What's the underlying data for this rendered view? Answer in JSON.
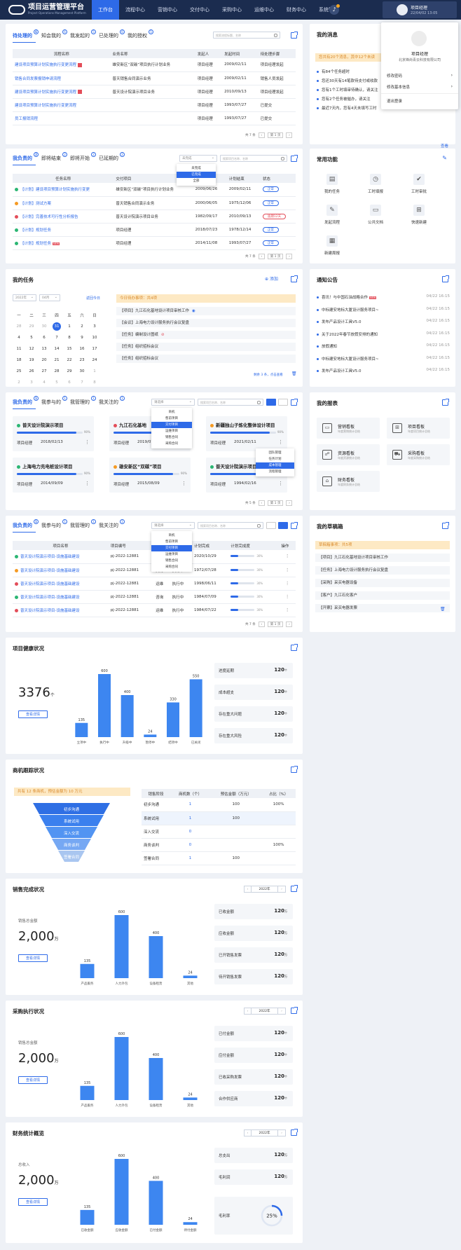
{
  "header": {
    "title": "项目运营管理平台",
    "subtitle": "Project Operations Management Platform",
    "nav": [
      "工作台",
      "流程中心",
      "营销中心",
      "交付中心",
      "采购中心",
      "运维中心",
      "财务中心",
      "系统管理"
    ],
    "user_name": "项目经理",
    "user_date": "22/04/02 13:05"
  },
  "profile": {
    "name": "项目经理",
    "company": "北京锋尚青云科技有限公司",
    "items": [
      "修改密码",
      "修改基本信息",
      "退出登录"
    ]
  },
  "todo": {
    "tabs": [
      "待处理的",
      "知会我的",
      "我发起的",
      "已处理的",
      "我的授权"
    ],
    "badges": [
      "6",
      "6",
      "5",
      "6",
      "5"
    ],
    "search": "搜索流程标题、名称",
    "headers": [
      "流程名称",
      "业务名称",
      "发起人",
      "发起时间",
      "待处理步骤"
    ],
    "rows": [
      [
        "建设项目预算计划实施执行变更流程",
        "雄安新区“双碳”项目执行计划业务",
        "项目经理",
        "2009/02/11",
        "项目经理发起"
      ],
      [
        "销售合同发票报销申请流程",
        "普天销售合同演示业务",
        "项目经理",
        "2009/02/11",
        "销售人员发起"
      ],
      [
        "建设项目预算计划实施执行变更流程",
        "普天设计院演示项目业务",
        "项目经理",
        "2010/09/13",
        "项目经理发起"
      ],
      [
        "建设项目预算计划实施执行变更流程",
        "",
        "项目经理",
        "1993/07/27",
        "已提交"
      ],
      [
        "员工报销流程",
        "",
        "项目经理",
        "1993/07/27",
        "已提交"
      ]
    ],
    "pager": {
      "total": "共 7 条",
      "page": "第 1 页"
    }
  },
  "messages": {
    "title": "我的消息",
    "notice": "您共有20个消息，其中12个未读",
    "rows": [
      "有84个任务超时",
      "您还30天有14笔款待支付或收款",
      "您有1个工时填审待确认，请关注",
      "您有2个任务被催办，请关注",
      "最近7天内，您有4天未填写工时"
    ],
    "view": "查看"
  },
  "resp": {
    "tabs": [
      "我负责的",
      "即将结束",
      "即将开始",
      "已延期的"
    ],
    "badges": [
      "2",
      "2",
      "2",
      "2"
    ],
    "filter": "未完成",
    "search": "搜索项目名称、名称",
    "dropdown": [
      "未完成",
      "已完成",
      "全部"
    ],
    "headers": [
      "任务名称",
      "交付项目",
      "计划开始",
      "计划结束",
      "状态"
    ],
    "rows": [
      [
        "【计划】建设项目预算计划实施执行变更",
        "雄安新区“双碳”项目执行计划业务",
        "2009/06/26",
        "2009/02/11",
        "正常"
      ],
      [
        "【计划】测试方案",
        "普天销售合同演示业务",
        "2000/06/05",
        "1975/12/06",
        "正常"
      ],
      [
        "【计划】完善技术可行性分析报告",
        "普天设计院演示项目业务",
        "1982/09/17",
        "2010/09/13",
        "逾期12天"
      ],
      [
        "【计划】规划任务",
        "项目经理",
        "2018/07/23",
        "1978/12/14",
        "正常"
      ],
      [
        "【计划】规划任务",
        "项目经理",
        "2014/11/08",
        "1993/07/27",
        "正常"
      ]
    ],
    "dotcolors": [
      "#2bb673",
      "#f59a23",
      "#e34d59",
      "#2bb673",
      "#2bb673"
    ],
    "pager": {
      "total": "共 7 条",
      "page": "第 1 页"
    }
  },
  "quick": {
    "title": "常用功能",
    "items": [
      "我的任务",
      "工时填报",
      "工时审批",
      "发起流程",
      "公共文档",
      "快速新建",
      "新建周报"
    ]
  },
  "mytask": {
    "title": "我的任务",
    "add": "添加",
    "year": "2022年",
    "month": "04月",
    "back": "返回今日",
    "weekdays": [
      "一",
      "二",
      "三",
      "四",
      "五",
      "六",
      "日"
    ],
    "weeks": [
      [
        "28",
        "29",
        "30",
        "31",
        "1",
        "2",
        "3"
      ],
      [
        "4",
        "5",
        "6",
        "7",
        "8",
        "9",
        "10"
      ],
      [
        "11",
        "12",
        "13",
        "14",
        "15",
        "16",
        "17"
      ],
      [
        "18",
        "19",
        "20",
        "21",
        "22",
        "23",
        "24"
      ],
      [
        "25",
        "26",
        "27",
        "28",
        "29",
        "30",
        "1"
      ],
      [
        "2",
        "3",
        "4",
        "5",
        "6",
        "7",
        "8"
      ]
    ],
    "notice": "今日待办事项：共4项",
    "items": [
      "【项目】九江石化基地设计项目审核工作",
      "【会议】上海电力设计服务执行会议复盘",
      "【任务】编制设计图纸",
      "【任务】组织招标会议",
      "【任务】组织招标会议"
    ],
    "more": "剩余 3 条，点击查看"
  },
  "notices": {
    "title": "通知公告",
    "new": "NEW",
    "rows": [
      [
        "喜讯！与中国石油战略合作",
        "04/22 16:15"
      ],
      [
        "中标建安地标大厦设计服务项目~",
        "04/22 16:15"
      ],
      [
        "发布产品设计工具V5.0",
        "04/22 16:15"
      ],
      [
        "关于2022年春节放假安排的通知",
        "04/22 16:15"
      ],
      [
        "放假通知",
        "04/22 16:15"
      ],
      [
        "中标建安地标大厦设计服务项目~",
        "04/22 16:15"
      ],
      [
        "发布产品设计工具V5.0",
        "04/22 16:15"
      ]
    ]
  },
  "projects": {
    "tabs": [
      "我负责的",
      "我参与的",
      "我管理的",
      "我关注的"
    ],
    "badges": [
      "1",
      "1",
      "1",
      "1"
    ],
    "filter": "请选择",
    "search": "搜索项目名称、名称",
    "dropdown": [
      "商机",
      "售前项目",
      "交付项目",
      "运维项目",
      "销售合同",
      "采购合同"
    ],
    "cards": [
      {
        "name": "普天设计院演示项目",
        "role": "项目经理",
        "date": "2018/02/13",
        "pct": "90%",
        "progress": 0.9,
        "color": "#2bb673"
      },
      {
        "name": "九江石化基地",
        "role": "项目经理",
        "date": "2019/07/23",
        "pct": "90%",
        "progress": 0.9,
        "color": "#e34d59"
      },
      {
        "name": "新疆独山子炼化整体设计项目",
        "role": "项目经理",
        "date": "2021/02/11",
        "pct": "90%",
        "progress": 0.9,
        "color": "#f59a23"
      },
      {
        "name": "上海电力充电桩设计项目",
        "role": "项目经理",
        "date": "2014/09/09",
        "pct": "90%",
        "progress": 0.9,
        "color": "#2bb673"
      },
      {
        "name": "雄安新区“双碳”项目",
        "role": "项目经理",
        "date": "2015/08/09",
        "pct": "90%",
        "progress": 0.9,
        "color": "#f59a23"
      },
      {
        "name": "普天设计院演示项目",
        "role": "项目经理",
        "date": "1994/02/16",
        "pct": "90%",
        "progress": 0.9,
        "color": "#2bb673"
      }
    ],
    "menu": [
      "团队管理",
      "任务计划",
      "成本管理",
      "流程管理"
    ],
    "pager": {
      "total": "共 5 条",
      "page": "第 1 页"
    }
  },
  "reports": {
    "title": "我的报表",
    "tiles": [
      {
        "t": "营销看板",
        "s": "年度营销统计总结"
      },
      {
        "t": "项目看板",
        "s": "年度项目统计总结"
      },
      {
        "t": "资源看板",
        "s": "年度资源统计总结"
      },
      {
        "t": "采购看板",
        "s": "年度采购统计总结"
      },
      {
        "t": "财务看板",
        "s": "年度财务统计总结"
      }
    ]
  },
  "ptable": {
    "tabs": [
      "我负责的",
      "我参与的",
      "我管理的",
      "我关注的"
    ],
    "badges": [
      "1",
      "1",
      "1",
      "1"
    ],
    "filter": "请选择",
    "search": "搜索项目名称、名称",
    "dropdown": [
      "商机",
      "售前项目",
      "交付项目",
      "运维项目",
      "销售合同",
      "采购合同"
    ],
    "headers": [
      "项目名称",
      "项目编号",
      "类型",
      "状态",
      "计划完成",
      "计划完成度",
      "操作"
    ],
    "rows": [
      [
        "普天设计院演示项目-设施基础建设",
        "pj-2022-12881",
        "交付",
        "执行中",
        "2020/10/29",
        "30%"
      ],
      [
        "普天设计院演示项目-设施基础建设",
        "pj-2022-12881",
        "交付",
        "执行中",
        "1972/07/28",
        "30%"
      ],
      [
        "普天设计院演示项目-设施基础建设",
        "pj-2022-12881",
        "运维",
        "执行中",
        "1998/06/11",
        "30%"
      ],
      [
        "普天设计院演示项目-设施基础建设",
        "pj-2022-12881",
        "咨询",
        "执行中",
        "1984/07/09",
        "30%"
      ],
      [
        "普天设计院演示项目-设施基础建设",
        "pj-2022-12881",
        "运维",
        "执行中",
        "1984/07/22",
        "30%"
      ]
    ],
    "progress": [
      0.3,
      0.3,
      0.3,
      0.3,
      0.3
    ],
    "dotcolors": [
      "#2bb673",
      "#f59a23",
      "#e34d59",
      "#2bb673",
      "#e34d59"
    ],
    "pager": {
      "total": "共 7 条",
      "page": "第 1 页"
    }
  },
  "drafts": {
    "title": "我的草稿箱",
    "notice": "草稿箱事项：共5项",
    "items": [
      "【项目】九江石化基地设计项目审核工作",
      "【任务】上海电力设计服务执行会议复盘",
      "【采购】采买电器设备",
      "【客户】九江石化客户",
      "【开票】采买电器发票"
    ]
  },
  "health": {
    "title": "项目健康状况",
    "total": "3376",
    "unit": "个",
    "btn": "查看详情",
    "stats": [
      [
        "进度延期",
        "120"
      ],
      [
        "成本超支",
        "120"
      ],
      [
        "存在重大问题",
        "120"
      ],
      [
        "存在重大风险",
        "120"
      ]
    ],
    "statunit": "个"
  },
  "funnel": {
    "title": "商机跟踪状况",
    "notice": "共有 12 条商机，预估金额为 10 万元",
    "stages": [
      "初步沟通",
      "系统试用",
      "深入交流",
      "商务谈判",
      "签署合同"
    ],
    "headers": [
      "销售阶段",
      "商机数（个）",
      "预估金额（万元）",
      "占比（%）"
    ],
    "rows": [
      [
        "初步沟通",
        "1",
        "100",
        "100%"
      ],
      [
        "系统试用",
        "1",
        "100",
        ""
      ],
      [
        "深入交流",
        "0",
        "",
        ""
      ],
      [
        "商务谈判",
        "0",
        "",
        "100%"
      ],
      [
        "签署合同",
        "1",
        "100",
        ""
      ]
    ]
  },
  "sales": {
    "title": "销售完成状况",
    "year": "2022年",
    "label": "销售总金额",
    "total": "2,000",
    "unit": "万",
    "btn": "查看详情",
    "stats": [
      [
        "已收金额",
        "120"
      ],
      [
        "应收金额",
        "120"
      ],
      [
        "已开销售发票",
        "120"
      ],
      [
        "待开销售发票",
        "120"
      ]
    ],
    "statunit": "万"
  },
  "purchase": {
    "title": "采购执行状况",
    "year": "2022年",
    "label": "销售总金额",
    "total": "2,000",
    "unit": "万",
    "btn": "查看详情",
    "stats": [
      [
        "已付金额",
        "120"
      ],
      [
        "应付金额",
        "120"
      ],
      [
        "已收采购发票",
        "120"
      ],
      [
        "合作供应商",
        "120"
      ]
    ],
    "statunit": "个"
  },
  "finance": {
    "title": "财务统计概览",
    "year": "2022年",
    "label": "总收入",
    "total": "2,000",
    "unit": "万",
    "btn": "查看详情",
    "stats": [
      [
        "总支出",
        "120"
      ],
      [
        "毛利润",
        "120"
      ]
    ],
    "statunit": "万",
    "rate_label": "毛利率",
    "rate": "25%",
    "rate_value": 0.25
  },
  "chart_data": [
    {
      "type": "bar",
      "categories": [
        "立项中",
        "执行中",
        "升级中",
        "暂停中",
        "结项中",
        "已关闭"
      ],
      "values": [
        135,
        600,
        400,
        24,
        330,
        550
      ],
      "ylim": [
        0,
        600
      ]
    },
    {
      "type": "bar",
      "categories": [
        "产品服务",
        "人力外包",
        "设备租赁",
        "其他"
      ],
      "values": [
        135,
        600,
        400,
        24
      ],
      "ylim": [
        0,
        600
      ]
    },
    {
      "type": "bar",
      "categories": [
        "产品服务",
        "人力外包",
        "设备租赁",
        "其他"
      ],
      "values": [
        135,
        600,
        400,
        24
      ],
      "ylim": [
        0,
        600
      ]
    },
    {
      "type": "bar",
      "categories": [
        "已收金额",
        "应收金额",
        "已付金额",
        "待付金额"
      ],
      "values": [
        135,
        600,
        400,
        24
      ],
      "ylim": [
        0,
        600
      ]
    }
  ],
  "colors": {
    "accent": "#2e6ae8",
    "header": "#1b2c4f",
    "bar": "#3d86f0"
  }
}
